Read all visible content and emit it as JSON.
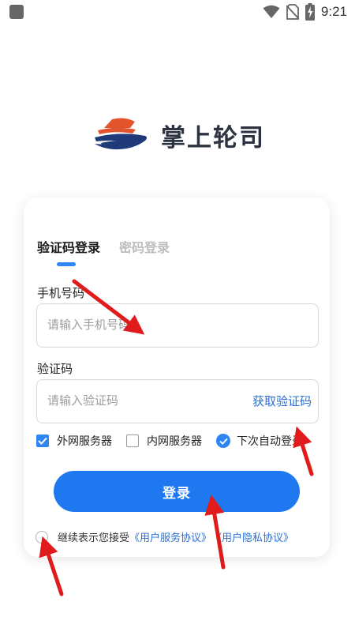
{
  "status_bar": {
    "time": "9:21",
    "icons": [
      "app-square-icon",
      "wifi-icon",
      "no-sim-icon",
      "battery-charging-icon"
    ]
  },
  "logo": {
    "text": "掌上轮司",
    "icon": "ship-logo-icon",
    "colors": {
      "orange": "#e2542d",
      "navy": "#1e3a78"
    }
  },
  "tabs": {
    "sms_login": "验证码登录",
    "password_login": "密码登录",
    "active": "sms_login"
  },
  "phone": {
    "label": "手机号码",
    "placeholder": "请输入手机号码",
    "value": ""
  },
  "code": {
    "label": "验证码",
    "placeholder": "请输入验证码",
    "value": "",
    "get_code": "获取验证码"
  },
  "options": {
    "external": {
      "label": "外网服务器",
      "checked": true
    },
    "internal": {
      "label": "内网服务器",
      "checked": false
    },
    "auto_login": {
      "label": "下次自动登录",
      "checked": true
    }
  },
  "login_button": "登录",
  "agreement": {
    "prefix": "继续表示您接受",
    "service": "《用户服务协议》",
    "privacy": "《用户隐私协议》",
    "checked": false
  },
  "colors": {
    "accent": "#1f78f0",
    "link": "#2b6fd6",
    "annotation_arrow": "#e01b1b"
  }
}
